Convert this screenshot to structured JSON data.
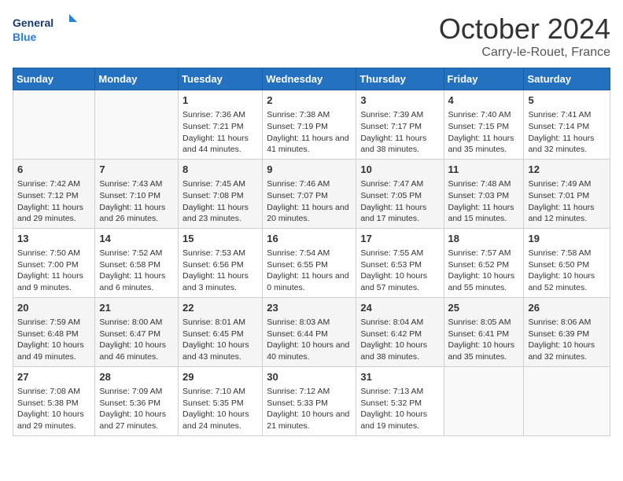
{
  "header": {
    "logo_general": "General",
    "logo_blue": "Blue",
    "month_title": "October 2024",
    "location": "Carry-le-Rouet, France"
  },
  "days_of_week": [
    "Sunday",
    "Monday",
    "Tuesday",
    "Wednesday",
    "Thursday",
    "Friday",
    "Saturday"
  ],
  "weeks": [
    [
      {
        "day": "",
        "info": ""
      },
      {
        "day": "",
        "info": ""
      },
      {
        "day": "1",
        "info": "Sunrise: 7:36 AM\nSunset: 7:21 PM\nDaylight: 11 hours and 44 minutes."
      },
      {
        "day": "2",
        "info": "Sunrise: 7:38 AM\nSunset: 7:19 PM\nDaylight: 11 hours and 41 minutes."
      },
      {
        "day": "3",
        "info": "Sunrise: 7:39 AM\nSunset: 7:17 PM\nDaylight: 11 hours and 38 minutes."
      },
      {
        "day": "4",
        "info": "Sunrise: 7:40 AM\nSunset: 7:15 PM\nDaylight: 11 hours and 35 minutes."
      },
      {
        "day": "5",
        "info": "Sunrise: 7:41 AM\nSunset: 7:14 PM\nDaylight: 11 hours and 32 minutes."
      }
    ],
    [
      {
        "day": "6",
        "info": "Sunrise: 7:42 AM\nSunset: 7:12 PM\nDaylight: 11 hours and 29 minutes."
      },
      {
        "day": "7",
        "info": "Sunrise: 7:43 AM\nSunset: 7:10 PM\nDaylight: 11 hours and 26 minutes."
      },
      {
        "day": "8",
        "info": "Sunrise: 7:45 AM\nSunset: 7:08 PM\nDaylight: 11 hours and 23 minutes."
      },
      {
        "day": "9",
        "info": "Sunrise: 7:46 AM\nSunset: 7:07 PM\nDaylight: 11 hours and 20 minutes."
      },
      {
        "day": "10",
        "info": "Sunrise: 7:47 AM\nSunset: 7:05 PM\nDaylight: 11 hours and 17 minutes."
      },
      {
        "day": "11",
        "info": "Sunrise: 7:48 AM\nSunset: 7:03 PM\nDaylight: 11 hours and 15 minutes."
      },
      {
        "day": "12",
        "info": "Sunrise: 7:49 AM\nSunset: 7:01 PM\nDaylight: 11 hours and 12 minutes."
      }
    ],
    [
      {
        "day": "13",
        "info": "Sunrise: 7:50 AM\nSunset: 7:00 PM\nDaylight: 11 hours and 9 minutes."
      },
      {
        "day": "14",
        "info": "Sunrise: 7:52 AM\nSunset: 6:58 PM\nDaylight: 11 hours and 6 minutes."
      },
      {
        "day": "15",
        "info": "Sunrise: 7:53 AM\nSunset: 6:56 PM\nDaylight: 11 hours and 3 minutes."
      },
      {
        "day": "16",
        "info": "Sunrise: 7:54 AM\nSunset: 6:55 PM\nDaylight: 11 hours and 0 minutes."
      },
      {
        "day": "17",
        "info": "Sunrise: 7:55 AM\nSunset: 6:53 PM\nDaylight: 10 hours and 57 minutes."
      },
      {
        "day": "18",
        "info": "Sunrise: 7:57 AM\nSunset: 6:52 PM\nDaylight: 10 hours and 55 minutes."
      },
      {
        "day": "19",
        "info": "Sunrise: 7:58 AM\nSunset: 6:50 PM\nDaylight: 10 hours and 52 minutes."
      }
    ],
    [
      {
        "day": "20",
        "info": "Sunrise: 7:59 AM\nSunset: 6:48 PM\nDaylight: 10 hours and 49 minutes."
      },
      {
        "day": "21",
        "info": "Sunrise: 8:00 AM\nSunset: 6:47 PM\nDaylight: 10 hours and 46 minutes."
      },
      {
        "day": "22",
        "info": "Sunrise: 8:01 AM\nSunset: 6:45 PM\nDaylight: 10 hours and 43 minutes."
      },
      {
        "day": "23",
        "info": "Sunrise: 8:03 AM\nSunset: 6:44 PM\nDaylight: 10 hours and 40 minutes."
      },
      {
        "day": "24",
        "info": "Sunrise: 8:04 AM\nSunset: 6:42 PM\nDaylight: 10 hours and 38 minutes."
      },
      {
        "day": "25",
        "info": "Sunrise: 8:05 AM\nSunset: 6:41 PM\nDaylight: 10 hours and 35 minutes."
      },
      {
        "day": "26",
        "info": "Sunrise: 8:06 AM\nSunset: 6:39 PM\nDaylight: 10 hours and 32 minutes."
      }
    ],
    [
      {
        "day": "27",
        "info": "Sunrise: 7:08 AM\nSunset: 5:38 PM\nDaylight: 10 hours and 29 minutes."
      },
      {
        "day": "28",
        "info": "Sunrise: 7:09 AM\nSunset: 5:36 PM\nDaylight: 10 hours and 27 minutes."
      },
      {
        "day": "29",
        "info": "Sunrise: 7:10 AM\nSunset: 5:35 PM\nDaylight: 10 hours and 24 minutes."
      },
      {
        "day": "30",
        "info": "Sunrise: 7:12 AM\nSunset: 5:33 PM\nDaylight: 10 hours and 21 minutes."
      },
      {
        "day": "31",
        "info": "Sunrise: 7:13 AM\nSunset: 5:32 PM\nDaylight: 10 hours and 19 minutes."
      },
      {
        "day": "",
        "info": ""
      },
      {
        "day": "",
        "info": ""
      }
    ]
  ]
}
